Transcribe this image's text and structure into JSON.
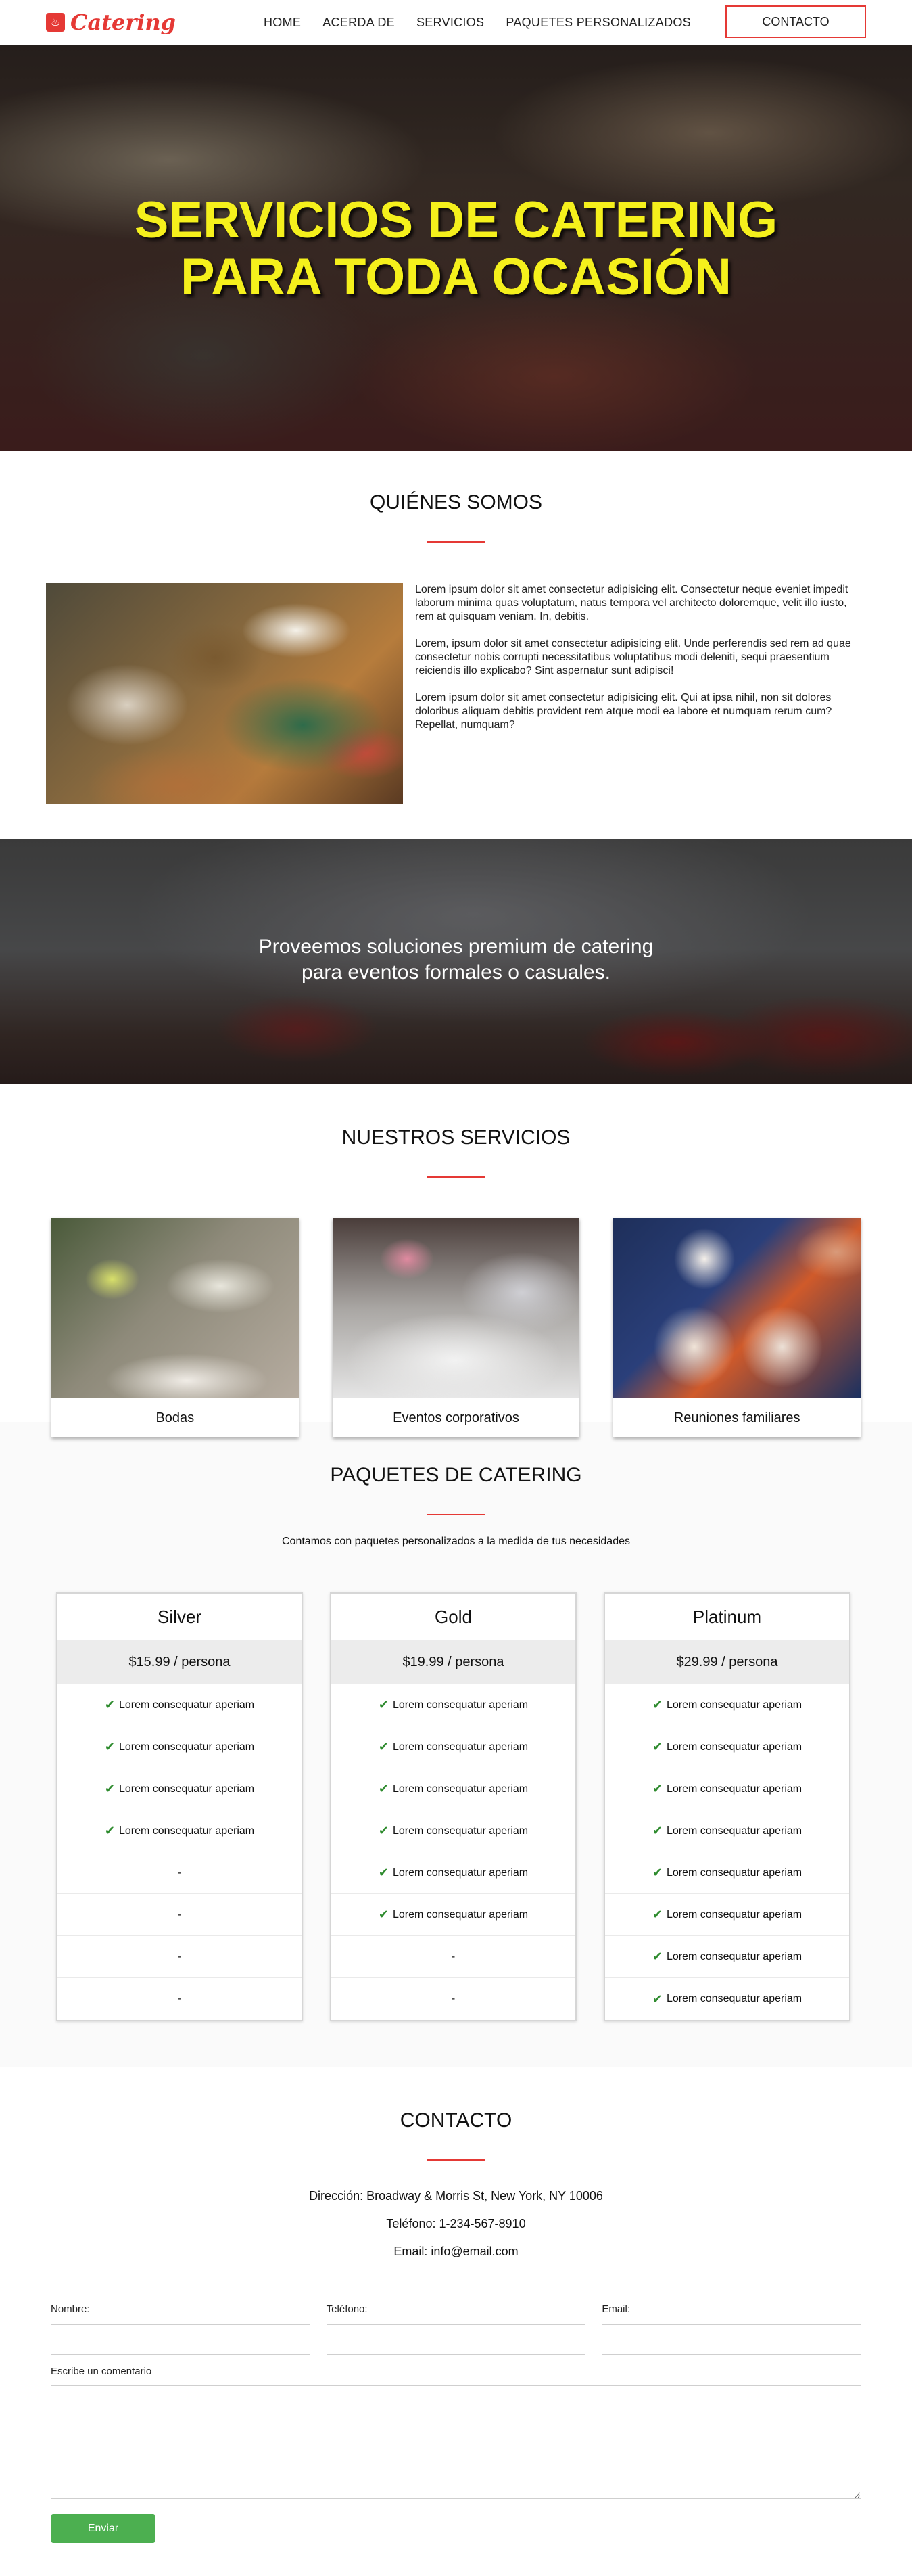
{
  "nav": {
    "logo_text": "Catering",
    "links": [
      "Home",
      "Acerda de",
      "Servicios",
      "Paquetes personalizados"
    ],
    "contact_label": "CONTACTO"
  },
  "hero": {
    "title_line1": "SERVICIOS DE CATERING",
    "title_line2": "PARA TODA OCASIÓN"
  },
  "about": {
    "title": "QUIÉNES SOMOS",
    "paragraphs": [
      "Lorem ipsum dolor sit amet consectetur adipisicing elit. Consectetur neque eveniet impedit laborum minima quas voluptatum, natus tempora vel architecto doloremque, velit illo iusto, rem at quisquam veniam. In, debitis.",
      "Lorem, ipsum dolor sit amet consectetur adipisicing elit. Unde perferendis sed rem ad quae consectetur nobis corrupti necessitatibus voluptatibus modi deleniti, sequi praesentium reiciendis illo explicabo? Sint aspernatur sunt adipisci!",
      "Lorem ipsum dolor sit amet consectetur adipisicing elit. Qui at ipsa nihil, non sit dolores doloribus aliquam debitis provident rem atque modi ea labore et numquam rerum cum? Repellat, numquam?"
    ]
  },
  "banner": {
    "line1": "Proveemos soluciones premium de catering",
    "line2": "para eventos formales o casuales."
  },
  "services": {
    "title": "NUESTROS SERVICIOS",
    "cards": [
      "Bodas",
      "Eventos corporativos",
      "Reuniones familiares"
    ]
  },
  "packages": {
    "title": "PAQUETES DE CATERING",
    "subtitle": "Contamos con paquetes personalizados a la medida de tus necesidades",
    "plans": [
      {
        "name": "Silver",
        "price": "$15.99 / persona",
        "features": [
          "Lorem consequatur aperiam",
          "Lorem consequatur aperiam",
          "Lorem consequatur aperiam",
          "Lorem consequatur aperiam",
          "-",
          "-",
          "-",
          "-"
        ]
      },
      {
        "name": "Gold",
        "price": "$19.99 / persona",
        "features": [
          "Lorem consequatur aperiam",
          "Lorem consequatur aperiam",
          "Lorem consequatur aperiam",
          "Lorem consequatur aperiam",
          "Lorem consequatur aperiam",
          "Lorem consequatur aperiam",
          "-",
          "-"
        ]
      },
      {
        "name": "Platinum",
        "price": "$29.99 / persona",
        "features": [
          "Lorem consequatur aperiam",
          "Lorem consequatur aperiam",
          "Lorem consequatur aperiam",
          "Lorem consequatur aperiam",
          "Lorem consequatur aperiam",
          "Lorem consequatur aperiam",
          "Lorem consequatur aperiam",
          "Lorem consequatur aperiam"
        ]
      }
    ]
  },
  "contact": {
    "title": "CONTACTO",
    "address": "Dirección: Broadway & Morris St, New York, NY 10006",
    "phone": "Teléfono: 1-234-567-8910",
    "email": "Email: info@email.com",
    "form": {
      "name_label": "Nombre:",
      "phone_label": "Teléfono:",
      "email_label": "Email:",
      "comment_label": "Escribe un comentario",
      "submit_label": "Enviar"
    }
  },
  "colors": {
    "accent": "#e53935",
    "hero_title": "#f5f01c",
    "submit": "#4caf50",
    "check": "#2e8b2e"
  }
}
